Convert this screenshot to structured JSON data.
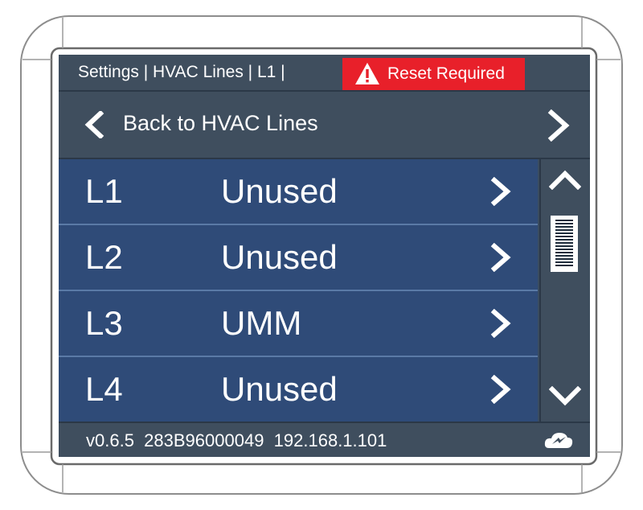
{
  "header": {
    "breadcrumb": "Settings | HVAC Lines | L1 |",
    "alert_label": "Reset Required",
    "alert_color": "#e8202a"
  },
  "nav": {
    "back_label": "Back to HVAC Lines"
  },
  "lines": [
    {
      "id": "L1",
      "value": "Unused"
    },
    {
      "id": "L2",
      "value": "Unused"
    },
    {
      "id": "L3",
      "value": "UMM"
    },
    {
      "id": "L4",
      "value": "Unused"
    }
  ],
  "footer": {
    "version": "v0.6.5",
    "serial": "283B96000049",
    "ip": "192.168.1.101"
  },
  "icons": {
    "back": "chevron-left-icon",
    "forward": "chevron-right-icon",
    "warning": "warning-triangle-icon",
    "scroll_up": "chevron-up-icon",
    "scroll_down": "chevron-down-icon",
    "logo": "cloud-logo-icon"
  },
  "colors": {
    "screen_bg": "#3a4c60",
    "row_bg": "#2f4b78",
    "header_bg": "#3f4e5e"
  }
}
